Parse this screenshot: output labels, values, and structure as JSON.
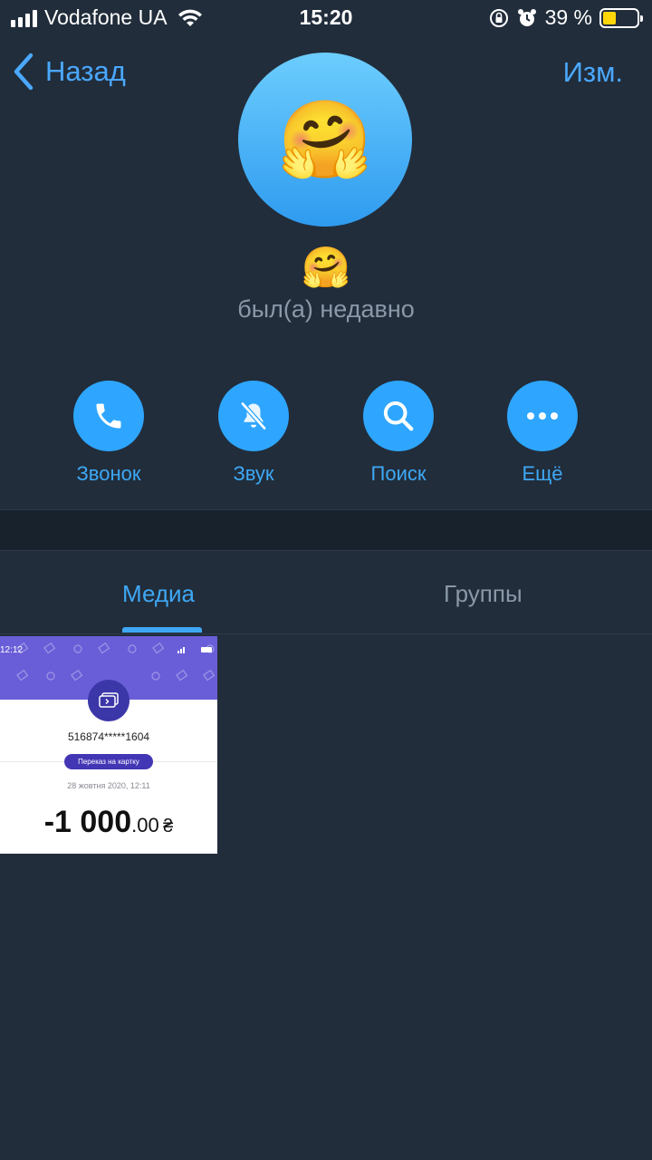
{
  "status_bar": {
    "carrier": "Vodafone UA",
    "time": "15:20",
    "battery_percent": "39 %",
    "battery_level": 0.39,
    "icons": [
      "signal-icon",
      "wifi-icon",
      "orientation-lock-icon",
      "alarm-icon",
      "battery-icon"
    ]
  },
  "nav": {
    "back_label": "Назад",
    "edit_label": "Изм."
  },
  "profile": {
    "avatar_emoji": "🤗",
    "name": "🤗",
    "last_seen": "был(а) недавно"
  },
  "actions": [
    {
      "label": "Звонок",
      "icon": "phone-icon"
    },
    {
      "label": "Звук",
      "icon": "bell-muted-icon"
    },
    {
      "label": "Поиск",
      "icon": "search-icon"
    },
    {
      "label": "Ещё",
      "icon": "more-icon"
    }
  ],
  "tabs": [
    {
      "label": "Медиа",
      "active": true
    },
    {
      "label": "Группы",
      "active": false
    }
  ],
  "media": [
    {
      "status_time": "12:12",
      "card_number": "516874*****1604",
      "type_label": "Переказ на картку",
      "date": "28 жовтня 2020, 12:11",
      "amount_main": "-1 000",
      "amount_cents": ".00",
      "currency": "₴"
    }
  ],
  "colors": {
    "background": "#212d3b",
    "accent": "#2ea6ff",
    "secondary_text": "#8a98a8"
  }
}
